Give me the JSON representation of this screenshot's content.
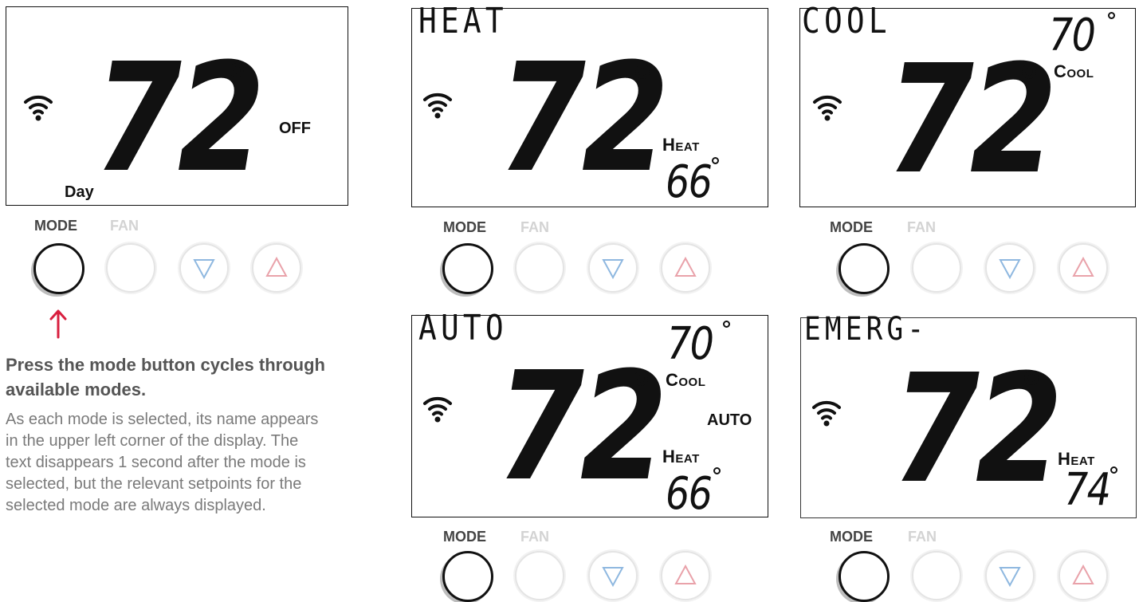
{
  "temperature": "72",
  "buttons": {
    "mode": "MODE",
    "fan": "FAN"
  },
  "panels": {
    "off": {
      "mode_text": "",
      "status": "OFF",
      "period": "Day"
    },
    "heat": {
      "mode_text": "HEAT",
      "heat_label": "Heat",
      "heat_setpoint": "66"
    },
    "cool": {
      "mode_text": "COOL",
      "cool_label": "Cool",
      "cool_setpoint": "70"
    },
    "auto": {
      "mode_text": "AUTO",
      "cool_label": "Cool",
      "cool_setpoint": "70",
      "status": "AUTO",
      "heat_label": "Heat",
      "heat_setpoint": "66"
    },
    "emerg": {
      "mode_text": "EMERG-",
      "heat_label": "Heat",
      "heat_setpoint": "74"
    }
  },
  "instruction": {
    "heading": "Press the mode button cycles through available modes.",
    "body": "As each mode is selected, its name appears in the upper left corner of the display. The text disappears 1 second after the mode is selected, but the relevant setpoints for the selected mode are always displayed."
  },
  "icons": [
    "wifi-icon",
    "degree-icon",
    "down-arrow-icon",
    "up-arrow-icon",
    "pointer-arrow-icon"
  ],
  "colors": {
    "arrow": "#d81f3f",
    "down_arrow": "#8fb8e0",
    "up_arrow": "#e9a2aa",
    "fan_label": "#d3d3d3"
  }
}
